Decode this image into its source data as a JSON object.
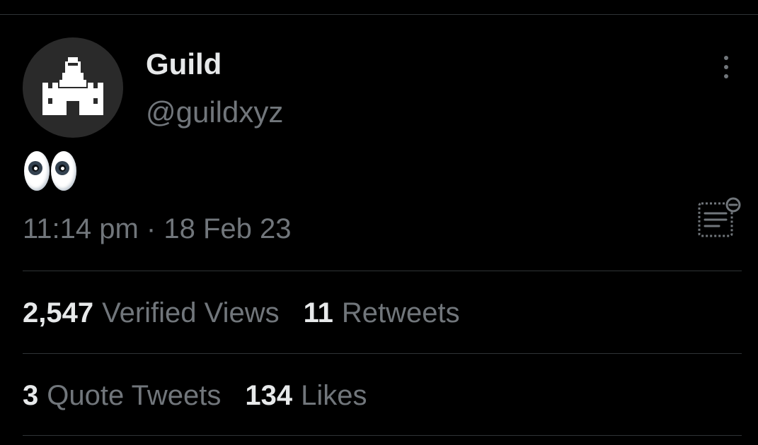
{
  "tweet": {
    "author": {
      "name": "Guild",
      "handle": "@guildxyz",
      "avatar_icon": "guild-castle-logo"
    },
    "content_emoji": "eyes-emoji",
    "timestamp": "11:14 pm · 18 Feb 23",
    "more_icon": "more-dots-icon",
    "notes_icon": "community-notes-icon"
  },
  "stats": {
    "row1": [
      {
        "count": "2,547",
        "label": "Verified Views"
      },
      {
        "count": "11",
        "label": "Retweets"
      }
    ],
    "row2": [
      {
        "count": "3",
        "label": "Quote Tweets"
      },
      {
        "count": "134",
        "label": "Likes"
      }
    ]
  },
  "colors": {
    "background": "#000000",
    "primary_text": "#e7e9ea",
    "secondary_text": "#71767b",
    "divider": "#2f3336",
    "avatar_bg": "#2a2a2a"
  }
}
